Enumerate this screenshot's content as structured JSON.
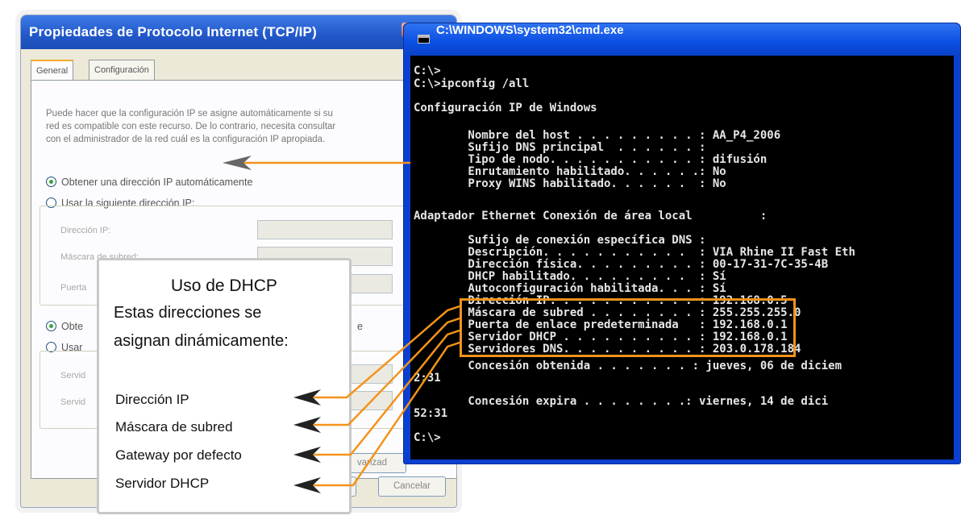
{
  "dialog": {
    "title": "Propiedades de Protocolo Internet (TCP/IP)",
    "tabs": [
      "General",
      "Configuración alternativa"
    ],
    "description_lines": [
      "Puede hacer que la configuración IP se asigne automáticamente si su",
      "red es compatible con este recurso. De lo contrario, necesita consultar",
      "con el administrador de la red cuál es la configuración IP apropiada."
    ],
    "radio_auto_ip": "Obtener una dirección IP automáticamente",
    "radio_manual_ip": "Usar la siguiente dirección IP:",
    "field_ip": "Dirección IP:",
    "field_mask": "Máscara de subred:",
    "field_gateway": "Puerta",
    "radio_auto_dns_fragment": "Obte",
    "radio_auto_dns_tail": "e",
    "radio_manual_dns_fragment": "Usar",
    "dns_pref_fragment": "Servid",
    "dns_alt_fragment": "Servid",
    "advanced_button_fragment": "vanzad",
    "cancel_button": "Cancelar"
  },
  "cmd": {
    "title": "C:\\WINDOWS\\system32\\cmd.exe",
    "lines": [
      "C:\\>",
      "C:\\>ipconfig /all",
      "Configuración IP de Windows",
      "        Nombre del host . . . . . . . . . : AA_P4_2006",
      "        Sufijo DNS principal  . . . . . . :",
      "        Tipo de nodo. . . . . . . . . . . : difusión",
      "        Enrutamiento habilitado. . . . . .: No",
      "        Proxy WINS habilitado. . . . . .  : No",
      "Adaptador Ethernet Conexión de área local          :",
      "        Sufijo de conexión específica DNS :",
      "        Descripción. . . . . . . . . . .  : VIA Rhine II Fast Eth",
      "        Dirección física. . . . . . . . . : 00-17-31-7C-35-4B",
      "        DHCP habilitado. . . . . . . . .  : Sí",
      "        Autoconfiguración habilitada. . . : Sí",
      "        Dirección IP. . . . . . . . . . . : 192.168.0.5",
      "        Máscara de subred . . . . . . . . : 255.255.255.0",
      "        Puerta de enlace predeterminada   : 192.168.0.1",
      "        Servidor DHCP . . . . . . . . . . : 192.168.0.1",
      "        Servidores DNS. . . . . . . . . . : 203.0.178.184",
      "        Concesión obtenida . . . . . . . : jueves, 06 de diciem",
      "2:31",
      "        Concesión expira . . . . . . . .: viernes, 14 de dici",
      "52:31",
      "C:\\>"
    ]
  },
  "callout": {
    "title": "Uso de DHCP",
    "line1": "Estas direcciones se",
    "line2": "asignan dinámicamente:",
    "items": [
      "Dirección IP",
      "Máscara de subred",
      "Gateway por defecto",
      "Servidor DHCP"
    ]
  },
  "colors": {
    "accent_orange": "#f3931a",
    "xp_title_blue": "#2257c9",
    "cmd_background": "#000000"
  }
}
